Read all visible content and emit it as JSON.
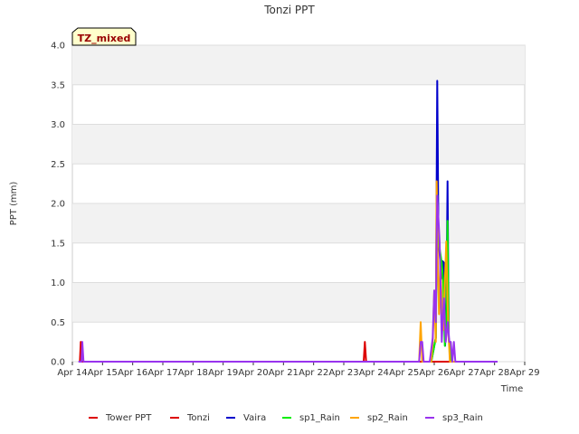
{
  "chart_data": {
    "type": "line",
    "title": "Tonzi PPT",
    "xlabel": "Time",
    "ylabel": "PPT (mm)",
    "badge": "TZ_mixed",
    "ylim": [
      0,
      4.0
    ],
    "yticks": [
      0.0,
      0.5,
      1.0,
      1.5,
      2.0,
      2.5,
      3.0,
      3.5,
      4.0
    ],
    "ytick_labels": [
      "0.0",
      "0.5",
      "1.0",
      "1.5",
      "2.0",
      "2.5",
      "3.0",
      "3.5",
      "4.0"
    ],
    "xlim": [
      14,
      29
    ],
    "xticks": [
      14,
      15,
      16,
      17,
      18,
      19,
      20,
      21,
      22,
      23,
      24,
      25,
      26,
      27,
      28,
      29
    ],
    "xtick_labels": [
      "Apr 14",
      "Apr 15",
      "Apr 16",
      "Apr 17",
      "Apr 18",
      "Apr 19",
      "Apr 20",
      "Apr 21",
      "Apr 22",
      "Apr 23",
      "Apr 24",
      "Apr 25",
      "Apr 26",
      "Apr 27",
      "Apr 28",
      "Apr 29"
    ],
    "grid": true,
    "legend_position": "bottom",
    "series": [
      {
        "name": "Tower PPT",
        "color": "#dd0000",
        "x": [],
        "y": []
      },
      {
        "name": "Tonzi",
        "color": "#dd0000",
        "x": [
          14.25,
          14.28,
          14.31,
          14.34,
          23.66,
          23.7,
          23.74,
          28.1
        ],
        "y": [
          0.0,
          0.25,
          0.0,
          0.0,
          0.0,
          0.25,
          0.0,
          0.0
        ]
      },
      {
        "name": "Vaira",
        "color": "#0000cc",
        "x": [
          25.7,
          25.9,
          26.05,
          26.1,
          26.14,
          26.2,
          26.24,
          26.28,
          26.32,
          26.36,
          26.4,
          26.44,
          26.48,
          26.5,
          26.55,
          26.6,
          26.65,
          26.7,
          28.1
        ],
        "y": [
          0.0,
          0.0,
          0.3,
          3.55,
          1.5,
          1.27,
          1.05,
          1.27,
          1.25,
          0.2,
          0.5,
          2.28,
          0.3,
          0.2,
          0.0,
          0.0,
          0.0,
          0.0,
          0.0
        ]
      },
      {
        "name": "sp1_Rain",
        "color": "#00ee00",
        "x": [
          25.7,
          25.9,
          26.05,
          26.1,
          26.15,
          26.25,
          26.3,
          26.35,
          26.4,
          26.44,
          26.48,
          26.52,
          26.56,
          26.6,
          28.1
        ],
        "y": [
          0.0,
          0.0,
          0.3,
          2.1,
          1.5,
          1.25,
          1.0,
          0.2,
          0.5,
          1.78,
          0.3,
          0.2,
          0.0,
          0.0,
          0.0
        ]
      },
      {
        "name": "sp2_Rain",
        "color": "#ffa500",
        "x": [
          25.0,
          25.5,
          25.55,
          25.6,
          25.9,
          25.95,
          26.0,
          26.05,
          26.08,
          26.12,
          26.16,
          26.2,
          26.3,
          26.35,
          26.4,
          26.44,
          26.48,
          26.52,
          26.56,
          26.6,
          28.1
        ],
        "y": [
          0.0,
          0.0,
          0.5,
          0.0,
          0.0,
          0.25,
          0.9,
          0.25,
          2.28,
          1.2,
          0.6,
          1.2,
          0.4,
          1.0,
          1.52,
          0.75,
          0.3,
          0.0,
          0.0,
          0.0,
          0.0
        ]
      },
      {
        "name": "sp3_Rain",
        "color": "#9933ee",
        "x": [
          14.2,
          14.3,
          14.33,
          14.37,
          15.0,
          25.5,
          25.55,
          25.6,
          25.65,
          25.85,
          25.95,
          26.0,
          26.05,
          26.1,
          26.18,
          26.25,
          26.32,
          26.38,
          26.45,
          26.5,
          26.55,
          26.6,
          26.65,
          26.7,
          28.1
        ],
        "y": [
          0.0,
          0.0,
          0.25,
          0.0,
          0.0,
          0.0,
          0.25,
          0.25,
          0.0,
          0.0,
          0.3,
          0.9,
          0.5,
          2.1,
          1.5,
          0.25,
          0.8,
          0.25,
          0.5,
          0.25,
          0.25,
          0.0,
          0.25,
          0.0,
          0.0
        ]
      }
    ]
  }
}
